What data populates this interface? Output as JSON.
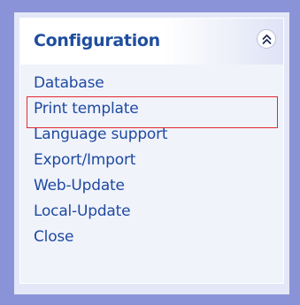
{
  "panel": {
    "title": "Configuration",
    "collapse_icon": "double-chevron-up-icon",
    "accent_color": "#1f4e9e",
    "frame_color": "#8b93d8",
    "highlight_color": "#e4292f"
  },
  "menu": {
    "items": [
      {
        "label": "Database"
      },
      {
        "label": "Print template",
        "highlighted": true
      },
      {
        "label": "Language support"
      },
      {
        "label": "Export/Import"
      },
      {
        "label": "Web-Update"
      },
      {
        "label": "Local-Update"
      },
      {
        "label": "Close"
      }
    ]
  }
}
